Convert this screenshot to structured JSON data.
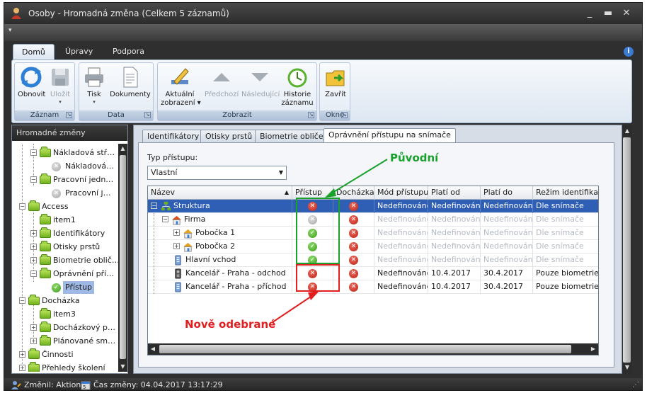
{
  "window": {
    "title": "Osoby - Hromadná změna (Celkem 5 záznamů)"
  },
  "ribbon": {
    "tabs": [
      "Domů",
      "Úpravy",
      "Podpora"
    ],
    "groups": {
      "zaznam": {
        "label": "Záznam",
        "refresh": "Obnovit",
        "save": "Uložit"
      },
      "data": {
        "label": "Data",
        "print": "Tisk",
        "documents": "Dokumenty"
      },
      "zobrazit": {
        "label": "Zobrazit",
        "current_view_1": "Aktuální",
        "current_view_2": "zobrazení",
        "prev": "Předchozí",
        "next": "Následující",
        "history_1": "Historie",
        "history_2": "záznamu"
      },
      "okno": {
        "label": "Okno",
        "close": "Zavřít"
      }
    }
  },
  "left_panel": {
    "title": "Hromadné změny",
    "items": [
      "Nákladová stř…",
      "Nákladová…",
      "Pracovní jedn…",
      "Pracovní j…",
      "Access",
      "item1",
      "Identifikátory",
      "Otisky prstů",
      "Biometrie oblič…",
      "Oprávnění pří…",
      "Přístup",
      "Docházka",
      "item3",
      "Docházkový p…",
      "Plánované sm…",
      "Činnosti",
      "Přehledy školení"
    ]
  },
  "content_tabs": [
    "Identifikátory",
    "Otisky prstů",
    "Biometrie obličeje",
    "Oprávnění přístupu na snímače"
  ],
  "access_type": {
    "label": "Typ přístupu:",
    "value": "Vlastní"
  },
  "grid": {
    "headers": [
      "Název",
      "Přístup",
      "Docházka",
      "Mód přístupu",
      "Platí od",
      "Platí do",
      "Režim identifikace"
    ],
    "rows": [
      {
        "name": "Struktura",
        "pristup": "x",
        "dochazka": "x",
        "mod": "Nedefinováno",
        "od": "Nedefinováno",
        "do": "Nedefinováno",
        "rezim": "Dle snímače"
      },
      {
        "name": "Firma",
        "pristup": "gray",
        "dochazka": "x",
        "mod": "Nedefinováno",
        "od": "Nedefinováno",
        "do": "Nedefinováno",
        "rezim": "Dle snímače"
      },
      {
        "name": "Pobočka 1",
        "pristup": "ok",
        "dochazka": "x",
        "mod": "Nedefinováno",
        "od": "Nedefinováno",
        "do": "Nedefinováno",
        "rezim": "Dle snímače"
      },
      {
        "name": "Pobočka 2",
        "pristup": "ok",
        "dochazka": "x",
        "mod": "Nedefinováno",
        "od": "Nedefinováno",
        "do": "Nedefinováno",
        "rezim": "Dle snímače"
      },
      {
        "name": "Hlavní vchod",
        "pristup": "ok",
        "dochazka": "x",
        "mod": "Nedefinováno",
        "od": "Nedefinováno",
        "do": "Nedefinováno",
        "rezim": "Dle snímače"
      },
      {
        "name": "Kancelář - Praha - odchod",
        "pristup": "x",
        "dochazka": "x",
        "mod": "Nedefinováno",
        "od": "10.4.2017",
        "do": "30.4.2017",
        "rezim": "Pouze biometrie"
      },
      {
        "name": "Kancelář - Praha - příchod",
        "pristup": "x",
        "dochazka": "x",
        "mod": "Nedefinováno",
        "od": "10.4.2017",
        "do": "30.4.2017",
        "rezim": "Pouze biometrie"
      }
    ]
  },
  "annotations": {
    "original": "Původní",
    "removed": "Nově odebrané"
  },
  "status_bar": {
    "changed_by": "Změnil: Aktion",
    "change_time": "Čas změny: 04.04.2017 13:17:29"
  },
  "colors": {
    "annotation_green": "#19a12c",
    "annotation_red": "#e02020",
    "selection": "#2f5fb5"
  }
}
